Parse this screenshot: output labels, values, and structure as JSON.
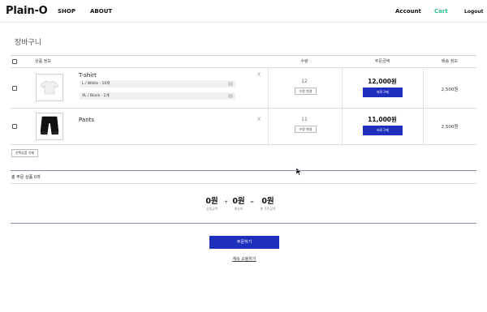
{
  "header": {
    "logo": "Plain-O",
    "nav": [
      "SHOP",
      "ABOUT"
    ],
    "account": "Account",
    "cart": "Cart",
    "logout": "Logout",
    "cart_color": "#2fc38a"
  },
  "page_title": "장바구니",
  "table": {
    "headers": {
      "product_info": "상품 정보",
      "quantity": "수량",
      "order_amount": "주문금액",
      "shipping": "배송 정보"
    },
    "rows": [
      {
        "name": "T-shirt",
        "options": [
          "L / White - 10개",
          "XL / Black - 2개"
        ],
        "remove": "X",
        "quantity": "12",
        "qty_change": "수량 변경",
        "price": "12,000원",
        "buy_now": "바로구매",
        "shipping": "2,500원",
        "image": "white-tshirt"
      },
      {
        "name": "Pants",
        "options": [],
        "remove": "X",
        "quantity": "11",
        "qty_change": "수량 변경",
        "price": "11,000원",
        "buy_now": "바로구매",
        "shipping": "2,500원",
        "image": "black-pants"
      }
    ],
    "delete_selected": "선택상품 삭제"
  },
  "total_items": "총 주문 상품 0개",
  "summary": {
    "product_amount": "0원",
    "product_amount_label": "상품금액",
    "plus": "+",
    "shipping_fee": "0원",
    "shipping_fee_label": "배송비",
    "equals": "=",
    "total": "0원",
    "total_label": "총 주문금액"
  },
  "order_button": "주문하기",
  "continue_shopping": "계속 쇼핑하기",
  "accent_color": "#1e2fbd"
}
